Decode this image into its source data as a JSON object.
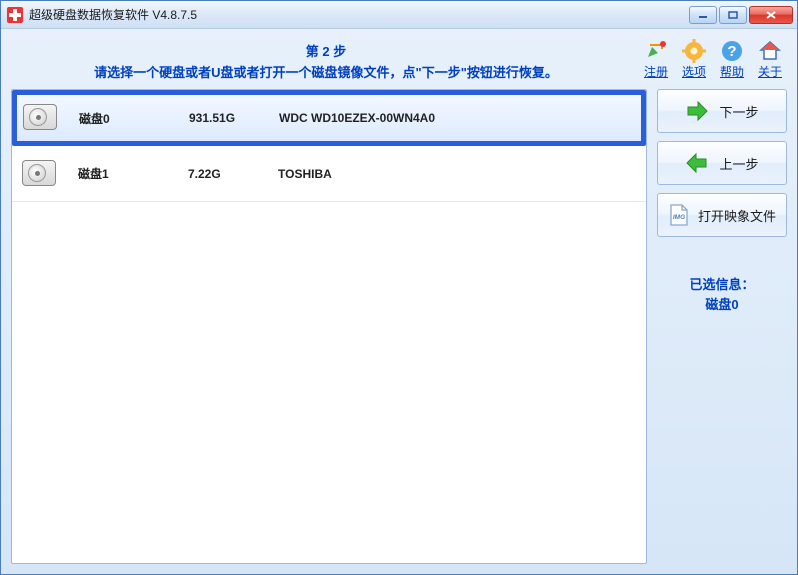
{
  "window": {
    "title": "超级硬盘数据恢复软件 V4.8.7.5"
  },
  "instructions": {
    "step_label": "第 2 步",
    "description": "请选择一个硬盘或者U盘或者打开一个磁盘镜像文件，点\"下一步\"按钮进行恢复。"
  },
  "toolbar": {
    "register": "注册",
    "options": "选项",
    "help": "帮助",
    "about": "关于"
  },
  "disks": [
    {
      "name": "磁盘0",
      "size": "931.51G",
      "model": "WDC WD10EZEX-00WN4A0",
      "selected": true
    },
    {
      "name": "磁盘1",
      "size": "7.22G",
      "model": "TOSHIBA",
      "selected": false
    }
  ],
  "side": {
    "next": "下一步",
    "prev": "上一步",
    "open_image": "打开映象文件",
    "img_badge": "IMG"
  },
  "selected_info": {
    "label": "已选信息：",
    "value": "磁盘0"
  }
}
